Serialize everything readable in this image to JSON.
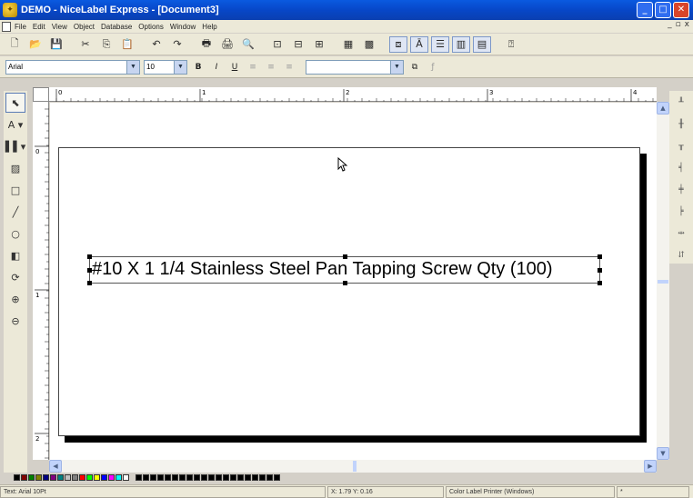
{
  "window": {
    "title": "DEMO - NiceLabel Express - [Document3]",
    "icon": "nicelabel-app-icon",
    "controls": {
      "minimize": "_",
      "maximize": "□",
      "close": "✕"
    }
  },
  "menu": {
    "items": [
      "File",
      "Edit",
      "View",
      "Object",
      "Database",
      "Options",
      "Window",
      "Help"
    ],
    "mdi_controls": {
      "minimize": "_",
      "restore": "▫",
      "close": "x"
    }
  },
  "toolbar_standard": {
    "buttons": [
      {
        "icon": "new-document-icon",
        "glyph": "🗋"
      },
      {
        "icon": "open-folder-icon",
        "glyph": "📂"
      },
      {
        "icon": "save-icon",
        "glyph": "💾"
      },
      {
        "icon": "cut-icon",
        "glyph": "✂"
      },
      {
        "icon": "copy-icon",
        "glyph": "⎘"
      },
      {
        "icon": "paste-icon",
        "glyph": "📋"
      },
      {
        "icon": "undo-icon",
        "glyph": "↶"
      },
      {
        "icon": "redo-icon",
        "glyph": "↷"
      },
      {
        "icon": "print-icon",
        "glyph": "🖶"
      },
      {
        "icon": "print-setup-icon",
        "glyph": "🖨"
      },
      {
        "icon": "print-preview-icon",
        "glyph": "🔍"
      },
      {
        "icon": "zoom-page-icon",
        "glyph": "⊡"
      },
      {
        "icon": "zoom-width-icon",
        "glyph": "⊟"
      },
      {
        "icon": "zoom-custom-icon",
        "glyph": "⊞"
      },
      {
        "icon": "grid-icon",
        "glyph": "▦"
      },
      {
        "icon": "snap-icon",
        "glyph": "▩"
      },
      {
        "icon": "align-left-objects-icon",
        "glyph": "⧈"
      },
      {
        "icon": "align-text-icon",
        "glyph": "Ā"
      },
      {
        "icon": "align-center-objects-icon",
        "glyph": "☰"
      },
      {
        "icon": "align-top-objects-icon",
        "glyph": "▥"
      },
      {
        "icon": "align-bottom-objects-icon",
        "glyph": "▤"
      },
      {
        "icon": "help-icon",
        "glyph": "⍰"
      }
    ]
  },
  "toolbar_format": {
    "font_name": "Arial",
    "font_size": "10",
    "bold": "B",
    "italic": "I",
    "underline": "U",
    "variable_combo": "",
    "buttons": [
      {
        "icon": "align-left-text-icon",
        "glyph": "≡"
      },
      {
        "icon": "align-center-text-icon",
        "glyph": "≡"
      },
      {
        "icon": "align-right-text-icon",
        "glyph": "≡"
      },
      {
        "icon": "variable-icon",
        "glyph": "⧉"
      },
      {
        "icon": "function-icon",
        "glyph": "ƒ"
      }
    ]
  },
  "toolbox": {
    "tools": [
      {
        "name": "select-tool",
        "glyph": "⬉",
        "selected": true
      },
      {
        "name": "text-tool",
        "glyph": "A ▾",
        "selected": false
      },
      {
        "name": "barcode-tool",
        "glyph": "▌▌▾",
        "selected": false
      },
      {
        "name": "picture-tool",
        "glyph": "▨",
        "selected": false
      },
      {
        "name": "rectangle-tool",
        "glyph": "□",
        "selected": false
      },
      {
        "name": "line-tool",
        "glyph": "╱",
        "selected": false
      },
      {
        "name": "ellipse-tool",
        "glyph": "○",
        "selected": false
      },
      {
        "name": "fill-tool",
        "glyph": "◧",
        "selected": false
      },
      {
        "name": "rotate-tool",
        "glyph": "⟳",
        "selected": false
      },
      {
        "name": "zoom-in-tool",
        "glyph": "⊕",
        "selected": false
      },
      {
        "name": "zoom-out-tool",
        "glyph": "⊖",
        "selected": false
      }
    ]
  },
  "right_toolbar": {
    "tools": [
      {
        "name": "align-top-icon",
        "glyph": "╨"
      },
      {
        "name": "align-middle-icon",
        "glyph": "╫"
      },
      {
        "name": "align-bottom-icon",
        "glyph": "╥"
      },
      {
        "name": "align-left-icon",
        "glyph": "╡"
      },
      {
        "name": "align-center-icon",
        "glyph": "╪"
      },
      {
        "name": "align-right-icon",
        "glyph": "╞"
      },
      {
        "name": "space-horizontal-icon",
        "glyph": "⇹"
      },
      {
        "name": "space-vertical-icon",
        "glyph": "⇵"
      }
    ]
  },
  "rulers": {
    "horizontal_labels": [
      "0",
      "1",
      "2",
      "3",
      "4"
    ],
    "vertical_labels": [
      "0",
      "1",
      "2"
    ]
  },
  "label": {
    "text": "#10 X 1 1/4 Stainless Steel Pan Tapping Screw Qty (100)"
  },
  "palette": {
    "colors": [
      "#000000",
      "#800000",
      "#008000",
      "#808000",
      "#000080",
      "#800080",
      "#008080",
      "#c0c0c0",
      "#808080",
      "#ff0000",
      "#00ff00",
      "#ffff00",
      "#0000ff",
      "#ff00ff",
      "#00ffff",
      "#ffffff",
      "#000000",
      "#000000",
      "#000000",
      "#000000",
      "#000000",
      "#000000",
      "#000000",
      "#000000",
      "#000000",
      "#000000",
      "#000000",
      "#000000",
      "#000000",
      "#000000",
      "#000000",
      "#000000",
      "#000000",
      "#000000",
      "#000000",
      "#000000"
    ]
  },
  "status": {
    "font": "Text: Arial 10Pt",
    "coords": "X: 1.79 Y: 0.16",
    "printer": "Color Label Printer (Windows)",
    "extra": "*"
  }
}
